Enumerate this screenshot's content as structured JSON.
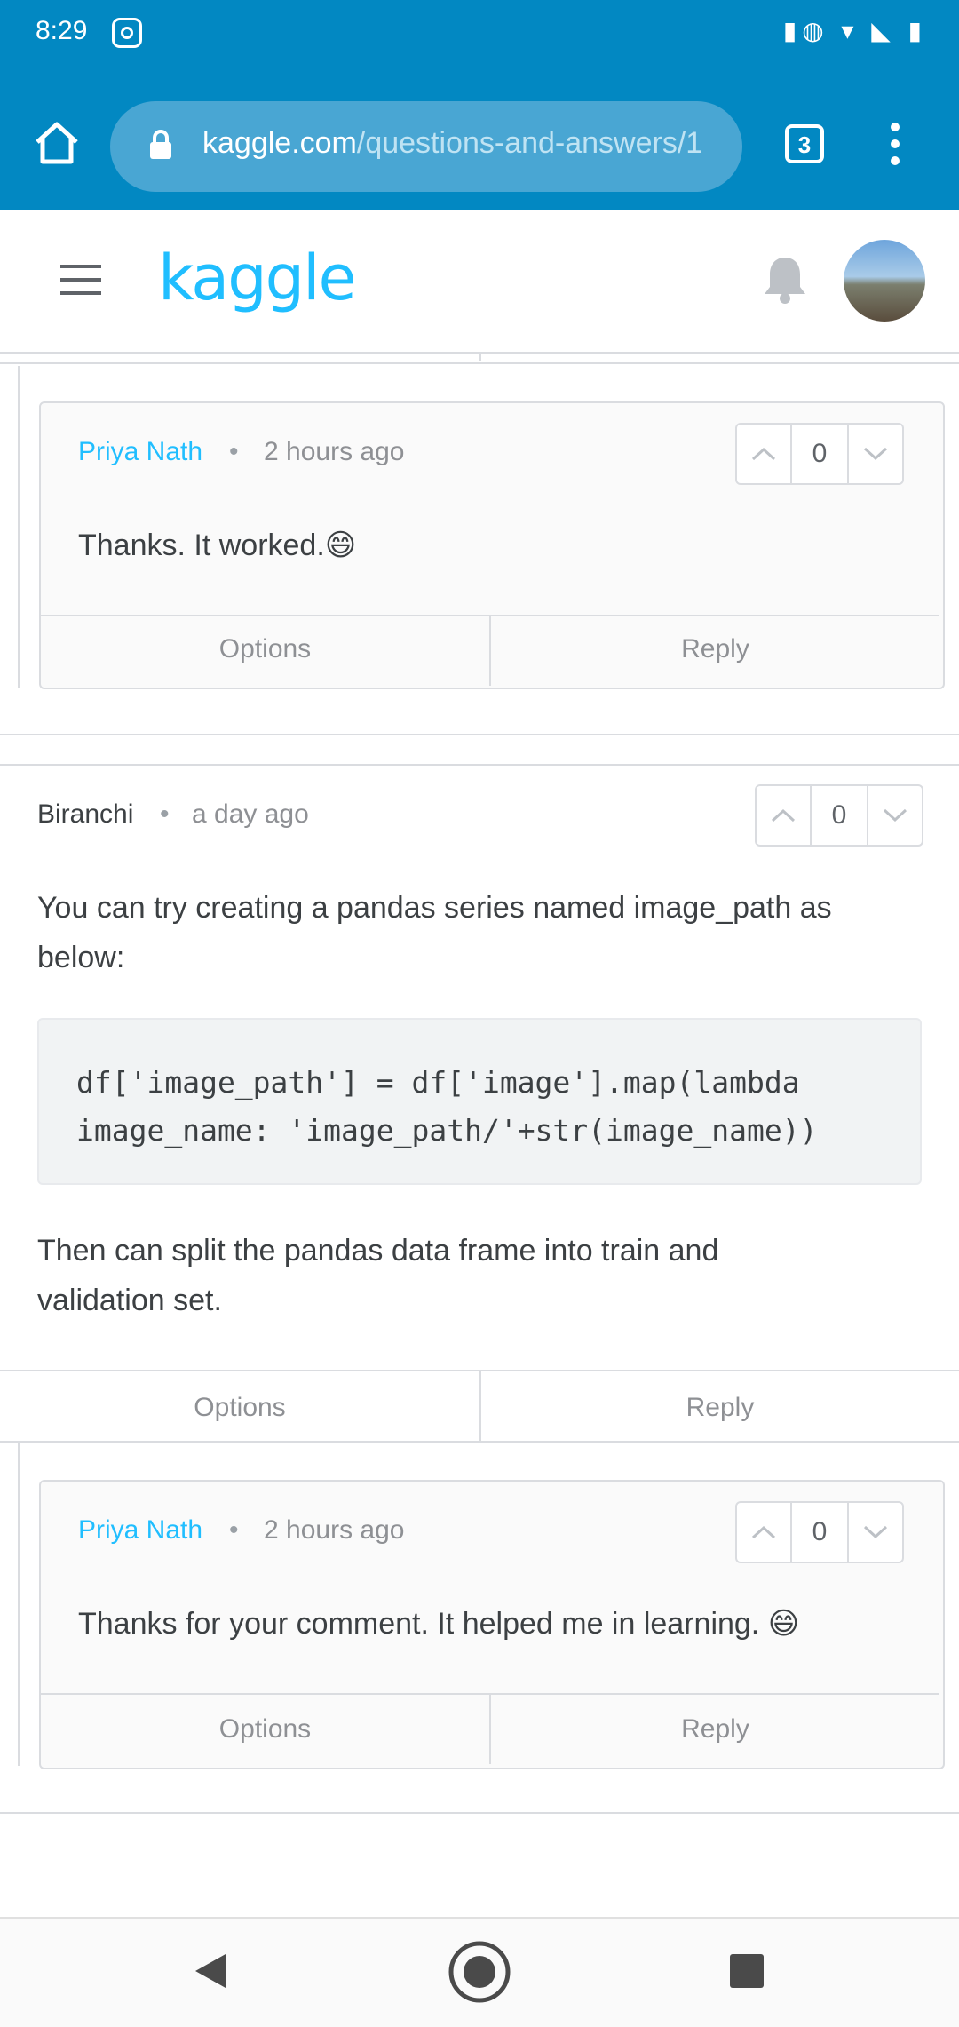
{
  "status": {
    "time": "8:29",
    "icons": "▮◍ ▾ ◣ ▮"
  },
  "browser": {
    "url_host": "kaggle.com",
    "url_path": "/questions-and-answers/1",
    "tab_count": "3"
  },
  "header": {
    "logo": "kaggle"
  },
  "reply1": {
    "author": "Priya Nath",
    "sep": "•",
    "time": "2 hours ago",
    "votes": "0",
    "text": "Thanks. It worked.😄",
    "options": "Options",
    "reply": "Reply"
  },
  "comment": {
    "author": "Biranchi",
    "sep": "•",
    "time": "a day ago",
    "votes": "0",
    "text1_line1": "You can try creating a pandas series named image_path as",
    "text1_line2": "below:",
    "code_line1": "df['image_path'] = df['image'].map(lambda",
    "code_line2": "image_name: 'image_path/'+str(image_name))",
    "text2_line1": "Then can split the pandas data frame into train and",
    "text2_line2": "validation set.",
    "options": "Options",
    "reply": "Reply"
  },
  "reply2": {
    "author": "Priya Nath",
    "sep": "•",
    "time": "2 hours ago",
    "votes": "0",
    "text": "Thanks for your comment. It helped me in learning. 😄",
    "options": "Options",
    "reply": "Reply"
  }
}
